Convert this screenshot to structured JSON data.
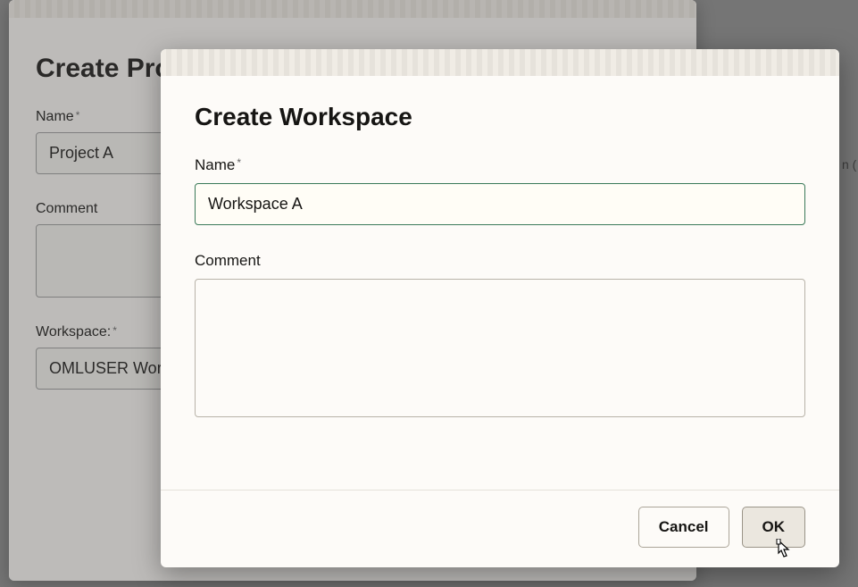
{
  "back_dialog": {
    "title": "Create Project",
    "name_label": "Name",
    "name_value": "Project A",
    "comment_label": "Comment",
    "comment_value": "",
    "workspace_label": "Workspace:",
    "workspace_value": "OMLUSER Workspace"
  },
  "front_dialog": {
    "title": "Create Workspace",
    "name_label": "Name",
    "name_value": "Workspace A",
    "comment_label": "Comment",
    "comment_value": "",
    "cancel_label": "Cancel",
    "ok_label": "OK"
  },
  "edge_text": "n ("
}
